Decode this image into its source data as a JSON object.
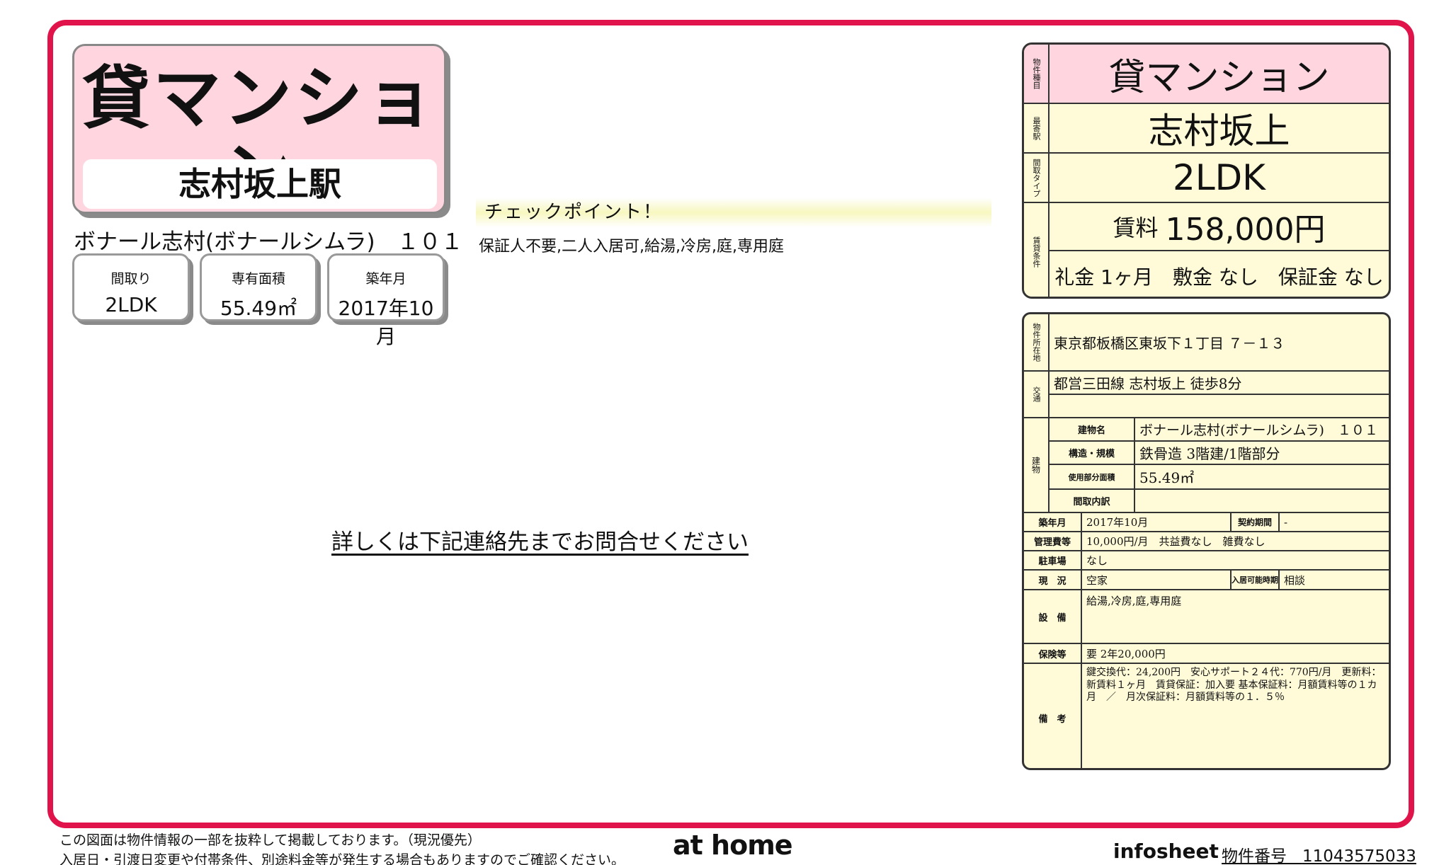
{
  "title": {
    "type": "貸マンション",
    "station": "志村坂上駅",
    "building": "ボナール志村(ボナールシムラ)　１０１"
  },
  "specs": [
    {
      "label": "間取り",
      "value": "2LDK"
    },
    {
      "label": "専有面積",
      "value": "55.49㎡"
    },
    {
      "label": "築年月",
      "value": "2017年10月"
    }
  ],
  "checkpoint": {
    "heading": "チェックポイント！",
    "text": "保証人不要,二人入居可,給湯,冷房,庭,専用庭"
  },
  "contact_note": "詳しくは下記連絡先までお問合せください",
  "summary": {
    "labels": {
      "type": "物件種目",
      "station": "最寄駅",
      "layout": "間取タイプ",
      "rent": "賃貸条件"
    },
    "type": "貸マンション",
    "station": "志村坂上",
    "layout": "2LDK",
    "rent_label": "賃料",
    "rent_value": "158,000円",
    "terms": "礼金 1ヶ月　敷金 なし　保証金 なし"
  },
  "details": {
    "location_label": "物件所在地",
    "location": "東京都板橋区東坂下１丁目 ７－１３",
    "transport_label": "交通",
    "transport_1": "都営三田線 志村坂上 徒歩8分",
    "transport_2": "",
    "building_label": "建物",
    "building_name_label": "建物名",
    "building_name": "ボナール志村(ボナールシムラ)　１０１",
    "structure_label": "構造・規模",
    "structure": "鉄骨造 3階建/1階部分",
    "area_label": "使用部分面積",
    "area": "55.49㎡",
    "layout_detail_label": "間取内訳",
    "layout_detail": "",
    "built_label": "築年月",
    "built": "2017年10月",
    "contract_period_label": "契約期間",
    "contract_period": "-",
    "management_label": "管理費等",
    "management": "10,000円/月　共益費なし　雑費なし",
    "parking_label": "駐車場",
    "parking": "なし",
    "status_label": "現　況",
    "status": "空家",
    "move_in_label": "入居可能時期",
    "move_in": "相談",
    "equipment_label": "設　備",
    "equipment": "給湯,冷房,庭,専用庭",
    "insurance_label": "保険等",
    "insurance": "要 2年20,000円",
    "remarks_label": "備　考",
    "remarks": "鍵交換代：24,200円　安心サポート２４代：770円/月　更新料：新賃料１ヶ月　賃貸保証：加入要 基本保証料：月額賃料等の１カ月　／　月次保証料：月額賃料等の１．５％"
  },
  "footer": {
    "note_1": "この図面は物件情報の一部を抜粋して掲載しております。（現況優先）",
    "note_2": "入居日・引渡日変更や付帯条件、別途料金等が発生する場合もありますのでご確認ください。",
    "brand": "at home",
    "infosheet": "infosheet",
    "property_number_label": "物件番号",
    "property_number": "11043575033"
  },
  "colors": {
    "frame": "#e0144a",
    "pink": "#ffd6e0",
    "cream": "#fffbd8"
  }
}
